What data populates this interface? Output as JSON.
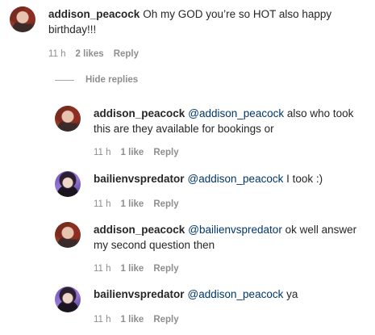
{
  "comments": [
    {
      "username": "addison_peacock",
      "text": "Oh my GOD you’re so HOT also happy birthday!!!",
      "mention": "",
      "time": "11 h",
      "likes": "2 likes",
      "reply": "Reply",
      "avatar": "red"
    },
    {
      "username": "addison_peacock",
      "mention": "@addison_peacock",
      "text": " also who took this are they available for bookings or",
      "time": "11 h",
      "likes": "1 like",
      "reply": "Reply",
      "avatar": "red"
    },
    {
      "username": "bailienvspredator",
      "mention": "@addison_peacock",
      "text": " I took :)",
      "time": "11 h",
      "likes": "1 like",
      "reply": "Reply",
      "avatar": "purple"
    },
    {
      "username": "addison_peacock",
      "mention": "@bailienvspredator",
      "text": " ok well answer my second question then",
      "time": "11 h",
      "likes": "1 like",
      "reply": "Reply",
      "avatar": "red"
    },
    {
      "username": "bailienvspredator",
      "mention": "@addison_peacock",
      "text": " ya",
      "time": "11 h",
      "likes": "1 like",
      "reply": "Reply",
      "avatar": "purple"
    }
  ],
  "hide_replies_label": "Hide replies"
}
